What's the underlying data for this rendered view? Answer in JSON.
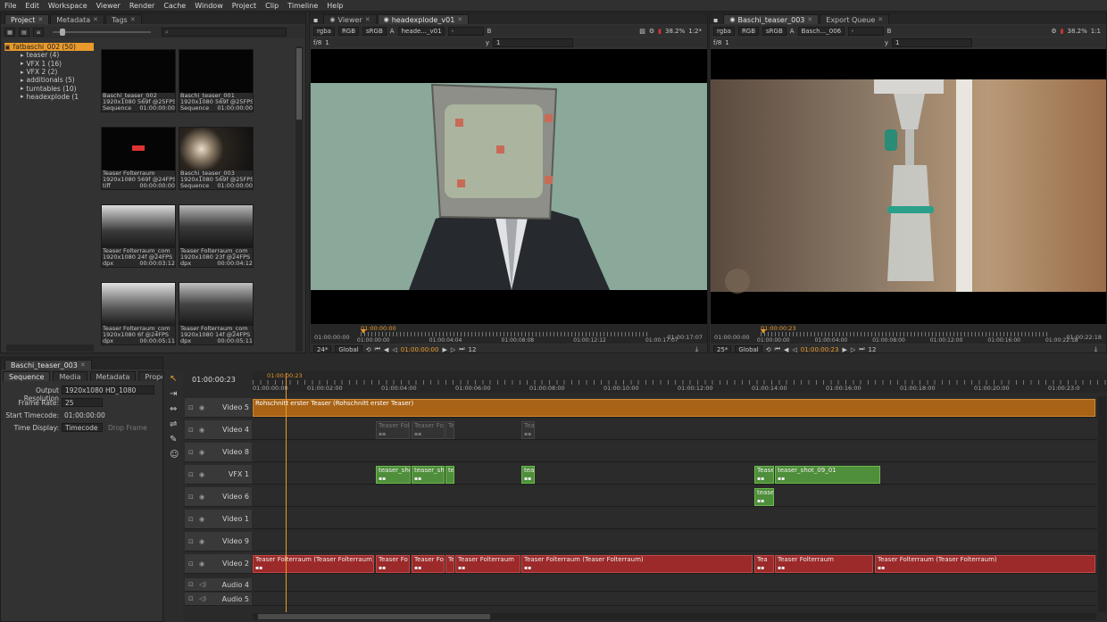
{
  "menu": [
    "File",
    "Edit",
    "Workspace",
    "Viewer",
    "Render",
    "Cache",
    "Window",
    "Project",
    "Clip",
    "Timeline",
    "Help"
  ],
  "project_panel": {
    "tabs": [
      "Project",
      "Metadata",
      "Tags"
    ],
    "tree": [
      {
        "label": "fatbaschi_002 (50)",
        "selected": true
      },
      {
        "label": "teaser (4)"
      },
      {
        "label": "VFX 1 (16)"
      },
      {
        "label": "VFX 2 (2)"
      },
      {
        "label": "additionals (5)"
      },
      {
        "label": "turntables (10)"
      },
      {
        "label": "headexplode (1"
      }
    ],
    "thumbs": [
      {
        "name": "Baschi_teaser_002",
        "info": "1920x1080 569f @25FPS",
        "kind": "Sequence",
        "tc": "01:00:00:00"
      },
      {
        "name": "Baschi_teaser_001",
        "info": "1920x1080 569f @25FPS",
        "kind": "Sequence",
        "tc": "01:00:00:00"
      },
      {
        "name": "Teaser Folterraum",
        "info": "1920x1080 569f @24FPS",
        "kind": "tiff",
        "tc": "00:00:00:00"
      },
      {
        "name": "Baschi_teaser_003",
        "info": "1920x1080 569f @25FPS",
        "kind": "Sequence",
        "tc": "01:00:00:00"
      },
      {
        "name": "Teaser Folterraum_com",
        "info": "1920x1080  24f @24FPS",
        "kind": "dpx",
        "tc": "00:00:03:12"
      },
      {
        "name": "Teaser Folterraum_com",
        "info": "1920x1080  23f @24FPS",
        "kind": "dpx",
        "tc": "00:00:04:12"
      },
      {
        "name": "Teaser Folterraum_com",
        "info": "1920x1080   6f @24FPS",
        "kind": "dpx",
        "tc": "00:00:05:11"
      },
      {
        "name": "Teaser Folterraum_com",
        "info": "1920x1080  14f @24FPS",
        "kind": "dpx",
        "tc": "00:00:05:11"
      }
    ]
  },
  "viewer1": {
    "tabs": [
      "Viewer",
      "headexplode_v01"
    ],
    "channels": "rgba",
    "colorspace": "RGB",
    "lut": "sRGB",
    "input_a": "A",
    "clip_a": "heade..._v01",
    "input_b": "B",
    "zoom": "38.2%",
    "ratio": "1:2*",
    "fstop": "f/8",
    "frame": "1",
    "y": "y",
    "ybox": "1",
    "tc_start": "01:00:00:00",
    "tc_cur": "01:00:00:00",
    "tc_end": "01:00:17:07",
    "ruler_labels": [
      "01:00:00:00",
      "01:00:04:04",
      "01:00:08:08",
      "01:00:12:12",
      "01:00:17:07"
    ],
    "fps": "24*",
    "mode": "Global",
    "step": "12",
    "playhead_tc": "01:00:00:00"
  },
  "viewer2": {
    "tabs": [
      "Baschi_teaser_003",
      "Export Queue"
    ],
    "channels": "rgba",
    "colorspace": "RGB",
    "lut": "sRGB",
    "input_a": "A",
    "clip_a": "Basch..._006",
    "input_b": "B",
    "zoom": "38.2%",
    "ratio": "1:1",
    "fstop": "f/8",
    "frame": "1",
    "y": "y",
    "ybox": "1",
    "tc_start": "01:00:00:00",
    "tc_cur": "01:00:00:23",
    "tc_end": "01:00:22:18",
    "ruler_labels": [
      "01:00:00:00",
      "01:00:04:00",
      "01:00:08:00",
      "01:00:12:00",
      "01:00:16:00",
      "01:00:22:18"
    ],
    "fps": "25*",
    "mode": "Global",
    "step": "12",
    "playhead_tc": "01:00:00:23"
  },
  "sequence_panel": {
    "title": "Baschi_teaser_003",
    "tabs": [
      "Sequence",
      "Media",
      "Metadata",
      "Properties"
    ],
    "fields": [
      {
        "label": "Output Resolution",
        "value": "1920x1080 HD_1080"
      },
      {
        "label": "Frame Rate:",
        "value": "25"
      },
      {
        "label": "Start Timecode:",
        "value": "01:00:00:00"
      },
      {
        "label": "Time Display:",
        "value": "Timecode"
      }
    ],
    "drop_frame": "Drop Frame"
  },
  "timeline": {
    "current_tc": "01:00:00:23",
    "playhead_tc": "01:00:00:23",
    "ruler": [
      "01:00:00:00",
      "01:00:02:00",
      "01:00:04:00",
      "01:00:06:00",
      "01:00:08:00",
      "01:00:10:00",
      "01:00:12:00",
      "01:00:14:00",
      "01:00:16:00",
      "01:00:18:00",
      "01:00:20:00",
      "01:00:23:0"
    ],
    "tracks": [
      {
        "name": "Video 5",
        "clips": [
          {
            "label": "Rohschnitt erster Teaser (Rohschnitt erster Teaser)",
            "color": "orange",
            "start": 0,
            "end": 944
          }
        ]
      },
      {
        "name": "Video 4",
        "clips": [
          {
            "label": "Teaser Fol",
            "color": "ghost",
            "start": 138,
            "end": 176
          },
          {
            "label": "Teaser Fol",
            "color": "ghost",
            "start": 178,
            "end": 215
          },
          {
            "label": "Te",
            "color": "ghost",
            "start": 216,
            "end": 226
          },
          {
            "label": "Tea",
            "color": "ghost",
            "start": 301,
            "end": 316
          }
        ]
      },
      {
        "name": "Video 8",
        "clips": []
      },
      {
        "name": "VFX 1",
        "clips": [
          {
            "label": "teaser_sho",
            "color": "green",
            "start": 138,
            "end": 177
          },
          {
            "label": "teaser_sho",
            "color": "green",
            "start": 178,
            "end": 215
          },
          {
            "label": "te",
            "color": "green",
            "start": 216,
            "end": 226
          },
          {
            "label": "tea",
            "color": "green",
            "start": 301,
            "end": 316
          },
          {
            "label": "Tease",
            "color": "green",
            "start": 562,
            "end": 584
          },
          {
            "label": "teaser_shot_09_01",
            "color": "green",
            "start": 585,
            "end": 703
          }
        ]
      },
      {
        "name": "Video 6",
        "clips": [
          {
            "label": "teaser",
            "color": "green",
            "start": 562,
            "end": 584
          }
        ]
      },
      {
        "name": "Video 1",
        "clips": []
      },
      {
        "name": "Video 9",
        "clips": []
      },
      {
        "name": "Video 2",
        "clips": [
          {
            "label": "Teaser Folterraum (Teaser Folterraum)",
            "color": "red",
            "start": 0,
            "end": 136
          },
          {
            "label": "Teaser Fo",
            "color": "red",
            "start": 138,
            "end": 176
          },
          {
            "label": "Teaser Fo",
            "color": "red",
            "start": 178,
            "end": 215
          },
          {
            "label": "Te",
            "color": "red",
            "start": 216,
            "end": 226
          },
          {
            "label": "Teaser Folterraum",
            "color": "red",
            "start": 227,
            "end": 300
          },
          {
            "label": "Teaser Folterraum (Teaser Folterraum)",
            "color": "red",
            "start": 301,
            "end": 560
          },
          {
            "label": "Tea",
            "color": "red",
            "start": 562,
            "end": 584
          },
          {
            "label": "Teaser Folterraum",
            "color": "red",
            "start": 585,
            "end": 695
          },
          {
            "label": "Teaser Folterraum (Teaser Folterraum)",
            "color": "red",
            "start": 697,
            "end": 944
          }
        ]
      },
      {
        "name": "Audio 4",
        "clips": []
      },
      {
        "name": "Audio 5",
        "clips": []
      }
    ]
  },
  "colors": {
    "accent": "#e89a2c",
    "clip_orange": "#a86316",
    "clip_green": "#4f8e3a",
    "clip_red": "#9c2a2a",
    "playhead": "#e89a2c"
  }
}
